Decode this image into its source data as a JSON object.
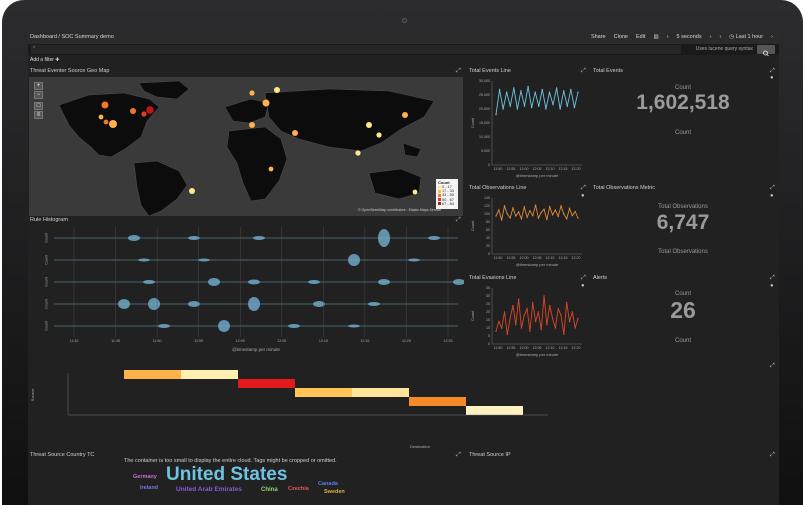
{
  "header": {
    "breadcrumb": "Dashboard / SOC Summary demo",
    "nav": [
      "Share",
      "Clone",
      "Edit",
      "▥",
      "‹",
      "5 seconds",
      "›",
      "‹",
      "◷ Last 1 hour",
      "›"
    ],
    "query_hint": "Uses lucene query syntax",
    "add_filter": "Add a filter ✚"
  },
  "panels": {
    "geo_map": {
      "title": "Threat Eventer Source Geo Map",
      "legend_title": "Count",
      "legend": [
        {
          "label": "0 - 17",
          "color": "#ffe98a"
        },
        {
          "label": "17 - 33",
          "color": "#ffb14a"
        },
        {
          "label": "33 - 50",
          "color": "#f07a24"
        },
        {
          "label": "50 - 67",
          "color": "#e33b1f"
        },
        {
          "label": "67 - 84",
          "color": "#c0151b"
        }
      ],
      "attribution": "© OpenStreetMap contributors · Elastic Maps Service",
      "zoom_in": "+",
      "zoom_out": "−"
    },
    "rule_histogram": {
      "title": "Rule Histogram",
      "x_label": "@timestamp per minute"
    },
    "total_events_line": {
      "title": "Total Events Line",
      "x_label": "@timestamp per minute",
      "y_label": "Count"
    },
    "total_events": {
      "title": "Total Events",
      "label": "Count",
      "value": "1,602,518",
      "sublabel": "Count"
    },
    "total_observations_line": {
      "title": "Total Observations Line",
      "x_label": "@timestamp per minute",
      "y_label": "Count"
    },
    "total_observations": {
      "title": "Total Observations Metric",
      "label": "Total Observations",
      "value": "6,747",
      "sublabel": "Total Observations"
    },
    "total_evasions_line": {
      "title": "Total Evasions Line",
      "x_label": "@timestamp per minute",
      "y_label": "Count"
    },
    "alerts": {
      "title": "Alerts",
      "label": "Count",
      "value": "26",
      "sublabel": "Count"
    },
    "heatmap": {
      "x_label": "Destination",
      "y_label": "Source"
    },
    "threat_source_country": {
      "title": "Threat Source Country TC",
      "warning": "The container is too small to display the entire cloud. Tags might be cropped or omitted.",
      "words": [
        {
          "text": "United States",
          "color": "#6fc3df"
        },
        {
          "text": "Germany",
          "color": "#c86fd3"
        },
        {
          "text": "United Arab Emirates",
          "color": "#8a5ad6"
        },
        {
          "text": "China",
          "color": "#8fd46f"
        },
        {
          "text": "Ireland",
          "color": "#6f7fe0"
        },
        {
          "text": "Canada",
          "color": "#5a7ee8"
        },
        {
          "text": "Sweden",
          "color": "#e0b040"
        },
        {
          "text": "Czechia",
          "color": "#e05a5a"
        }
      ]
    },
    "threat_source_ip": {
      "title": "Threat Source IP"
    }
  },
  "chart_data": [
    {
      "type": "line",
      "title": "Total Events Line",
      "x": [
        "11:50",
        "11:55",
        "12:00",
        "12:05",
        "12:10",
        "12:15",
        "12:20"
      ],
      "y_ticks": [
        0,
        5000,
        10000,
        15000,
        20000,
        25000,
        30000
      ],
      "ylabel": "Count",
      "xlabel": "@timestamp per minute",
      "color": "#6fc3df",
      "series": [
        {
          "values": [
            18000,
            27000,
            20000,
            26000,
            21000,
            27500,
            20000,
            26500,
            21000,
            28000,
            20500,
            26000,
            21000,
            27000,
            20000,
            26000,
            21500,
            27500,
            20000,
            26500,
            21000,
            27000,
            20500,
            26000
          ]
        }
      ]
    },
    {
      "type": "line",
      "title": "Total Observations Line",
      "x": [
        "11:50",
        "11:55",
        "12:00",
        "12:05",
        "12:10",
        "12:15",
        "12:20"
      ],
      "y_ticks": [
        0,
        20,
        40,
        60,
        80,
        100,
        120,
        140
      ],
      "ylabel": "Count",
      "xlabel": "@timestamp per minute",
      "color": "#e08a3a",
      "series": [
        {
          "values": [
            95,
            110,
            85,
            120,
            100,
            90,
            115,
            95,
            105,
            88,
            118,
            92,
            108,
            96,
            122,
            90,
            104,
            112,
            86,
            118,
            98,
            110,
            94,
            120,
            100,
            88,
            114,
            96,
            106,
            90
          ]
        }
      ]
    },
    {
      "type": "line",
      "title": "Total Evasions Line",
      "x": [
        "11:50",
        "11:55",
        "12:00",
        "12:05",
        "12:10",
        "12:15",
        "12:20"
      ],
      "y_ticks": [
        0,
        5,
        10,
        15,
        20,
        25,
        30,
        35
      ],
      "ylabel": "Count",
      "xlabel": "@timestamp per minute",
      "color": "#d9472b",
      "series": [
        {
          "values": [
            8,
            14,
            10,
            20,
            6,
            16,
            24,
            12,
            28,
            10,
            18,
            22,
            8,
            26,
            14,
            20,
            9,
            30,
            12,
            24,
            16,
            10,
            22,
            18,
            6,
            26,
            14,
            20,
            10,
            16
          ]
        }
      ]
    },
    {
      "type": "heatmap",
      "xlabel": "Destination",
      "ylabel": "Source",
      "cells": [
        {
          "row": 0,
          "start": 0,
          "end": 1,
          "color": "#ffb14a"
        },
        {
          "row": 0,
          "start": 1,
          "end": 2,
          "color": "#ffefb0"
        },
        {
          "row": 1,
          "start": 2,
          "end": 3,
          "color": "#e31a1c"
        },
        {
          "row": 2,
          "start": 3,
          "end": 4,
          "color": "#ffc45a"
        },
        {
          "row": 2,
          "start": 4,
          "end": 5,
          "color": "#ffe59a"
        },
        {
          "row": 3,
          "start": 5,
          "end": 6,
          "color": "#f58a28"
        },
        {
          "row": 4,
          "start": 6,
          "end": 7,
          "color": "#fff1c2"
        }
      ]
    }
  ]
}
